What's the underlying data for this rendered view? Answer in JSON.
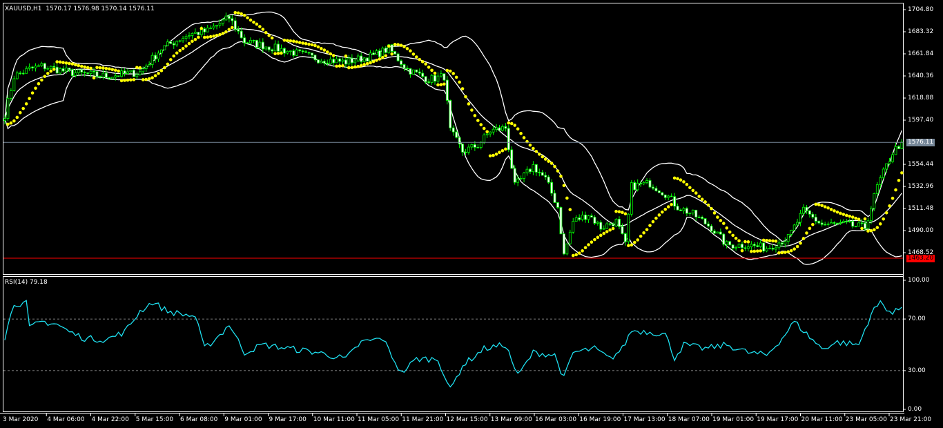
{
  "header": {
    "symbol": "XAUUSD,H1",
    "open": "1570.17",
    "high": "1576.98",
    "low": "1570.14",
    "close": "1576.11"
  },
  "rsi_header": {
    "name": "RSI(14)",
    "value": "79.18"
  },
  "colors": {
    "background": "#000000",
    "bull": "#00ff00",
    "body": "#ffffff",
    "bands": "#ffffff",
    "sar": "#ffff00",
    "rsi": "#1ee0f0",
    "price_line": "#778899",
    "alert_line": "#ff0000"
  },
  "price_axis": {
    "labels": [
      "1704.80",
      "1683.32",
      "1661.84",
      "1640.36",
      "1618.88",
      "1597.40",
      "1554.44",
      "1532.96",
      "1511.48",
      "1490.00",
      "1468.52"
    ],
    "current_price_tag": "1576.11",
    "alert_price_tag": "1463.20"
  },
  "rsi_axis": {
    "labels": [
      "100.00",
      "70.00",
      "30.00",
      "0.00"
    ]
  },
  "time_axis": {
    "labels": [
      "3 Mar 2020",
      "4 Mar 06:00",
      "4 Mar 22:00",
      "5 Mar 15:00",
      "6 Mar 08:00",
      "9 Mar 01:00",
      "9 Mar 17:00",
      "10 Mar 11:00",
      "11 Mar 05:00",
      "11 Mar 21:00",
      "12 Mar 15:00",
      "13 Mar 09:00",
      "16 Mar 03:00",
      "16 Mar 19:00",
      "17 Mar 13:00",
      "18 Mar 07:00",
      "19 Mar 01:00",
      "19 Mar 17:00",
      "20 Mar 11:00",
      "23 Mar 05:00",
      "23 Mar 21:00"
    ]
  },
  "chart_data": {
    "type": "candlestick",
    "symbol": "XAUUSD",
    "timeframe": "H1",
    "bars": 293,
    "ylim": [
      1452,
      1711
    ],
    "current_price": 1576.11,
    "alert_level": 1463.2,
    "close_keypoints": [
      [
        0,
        1603
      ],
      [
        3,
        1640
      ],
      [
        8,
        1647
      ],
      [
        12,
        1650
      ],
      [
        21,
        1644
      ],
      [
        33,
        1640
      ],
      [
        44,
        1644
      ],
      [
        51,
        1667
      ],
      [
        60,
        1681
      ],
      [
        66,
        1684
      ],
      [
        73,
        1697
      ],
      [
        78,
        1674
      ],
      [
        84,
        1670
      ],
      [
        93,
        1664
      ],
      [
        102,
        1657
      ],
      [
        111,
        1654
      ],
      [
        120,
        1660
      ],
      [
        125,
        1667
      ],
      [
        131,
        1647
      ],
      [
        138,
        1637
      ],
      [
        143,
        1640
      ],
      [
        145,
        1587
      ],
      [
        149,
        1567
      ],
      [
        154,
        1573
      ],
      [
        158,
        1587
      ],
      [
        163,
        1590
      ],
      [
        166,
        1533
      ],
      [
        172,
        1553
      ],
      [
        176,
        1540
      ],
      [
        180,
        1513
      ],
      [
        182,
        1466
      ],
      [
        185,
        1499
      ],
      [
        190,
        1506
      ],
      [
        194,
        1493
      ],
      [
        199,
        1499
      ],
      [
        202,
        1476
      ],
      [
        204,
        1533
      ],
      [
        210,
        1536
      ],
      [
        215,
        1526
      ],
      [
        219,
        1513
      ],
      [
        224,
        1506
      ],
      [
        230,
        1493
      ],
      [
        235,
        1476
      ],
      [
        242,
        1476
      ],
      [
        248,
        1473
      ],
      [
        255,
        1483
      ],
      [
        260,
        1509
      ],
      [
        266,
        1496
      ],
      [
        273,
        1496
      ],
      [
        280,
        1493
      ],
      [
        284,
        1533
      ],
      [
        289,
        1566
      ],
      [
        292,
        1576.11
      ]
    ],
    "indicators": [
      "Bollinger Bands(20,2)",
      "Parabolic SAR(0.02,0.2)",
      "RSI(14)"
    ],
    "rsi": {
      "levels": [
        70,
        30
      ],
      "ylim": [
        0,
        100
      ],
      "keypoints": [
        [
          0,
          56
        ],
        [
          3,
          82
        ],
        [
          7,
          82
        ],
        [
          8,
          63
        ],
        [
          12,
          68
        ],
        [
          17,
          66
        ],
        [
          21,
          60
        ],
        [
          26,
          55
        ],
        [
          33,
          54
        ],
        [
          39,
          60
        ],
        [
          44,
          76
        ],
        [
          48,
          83
        ],
        [
          53,
          76
        ],
        [
          57,
          74
        ],
        [
          62,
          72
        ],
        [
          65,
          47
        ],
        [
          71,
          60
        ],
        [
          73,
          66
        ],
        [
          78,
          44
        ],
        [
          84,
          50
        ],
        [
          93,
          47
        ],
        [
          102,
          44
        ],
        [
          111,
          39
        ],
        [
          116,
          52
        ],
        [
          123,
          55
        ],
        [
          129,
          28
        ],
        [
          134,
          39
        ],
        [
          141,
          39
        ],
        [
          145,
          15
        ],
        [
          149,
          34
        ],
        [
          156,
          47
        ],
        [
          163,
          50
        ],
        [
          167,
          26
        ],
        [
          172,
          44
        ],
        [
          179,
          42
        ],
        [
          182,
          24
        ],
        [
          185,
          44
        ],
        [
          192,
          47
        ],
        [
          197,
          39
        ],
        [
          201,
          47
        ],
        [
          204,
          61
        ],
        [
          210,
          60
        ],
        [
          215,
          58
        ],
        [
          218,
          40
        ],
        [
          221,
          50
        ],
        [
          228,
          47
        ],
        [
          235,
          50
        ],
        [
          242,
          44
        ],
        [
          248,
          42
        ],
        [
          253,
          55
        ],
        [
          257,
          68
        ],
        [
          262,
          56
        ],
        [
          266,
          47
        ],
        [
          271,
          52
        ],
        [
          278,
          50
        ],
        [
          282,
          74
        ],
        [
          285,
          83
        ],
        [
          289,
          74
        ],
        [
          292,
          79.18
        ]
      ]
    }
  }
}
